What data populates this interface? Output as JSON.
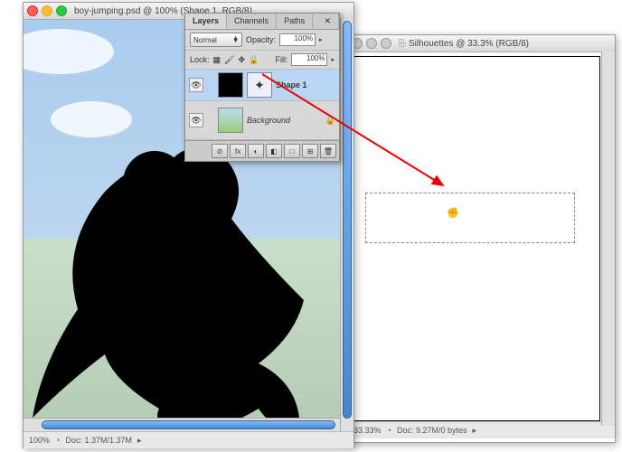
{
  "win1": {
    "title": "boy-jumping.psd @ 100% (Shape 1, RGB/8)",
    "zoom": "100%",
    "doc": "Doc: 1.37M/1.37M"
  },
  "win2": {
    "title": "Silhouettes @ 33.3% (RGB/8)",
    "zoom": "33.33%",
    "doc": "Doc: 9.27M/0 bytes",
    "doc_icon": "⎘"
  },
  "panel": {
    "tabs": [
      "Layers",
      "Channels",
      "Paths"
    ],
    "blend": "Normal",
    "opacity_lbl": "Opacity:",
    "opacity": "100%",
    "lock_lbl": "Lock:",
    "fill_lbl": "Fill:",
    "fill": "100%",
    "shape1": "Shape 1",
    "bg": "Background",
    "lock_icon": "🔒",
    "icons": [
      "⊘",
      "fx",
      "◐",
      "◧",
      "□",
      "⊞",
      "🗑"
    ]
  },
  "chevron": "▸",
  "cursor": "✊"
}
